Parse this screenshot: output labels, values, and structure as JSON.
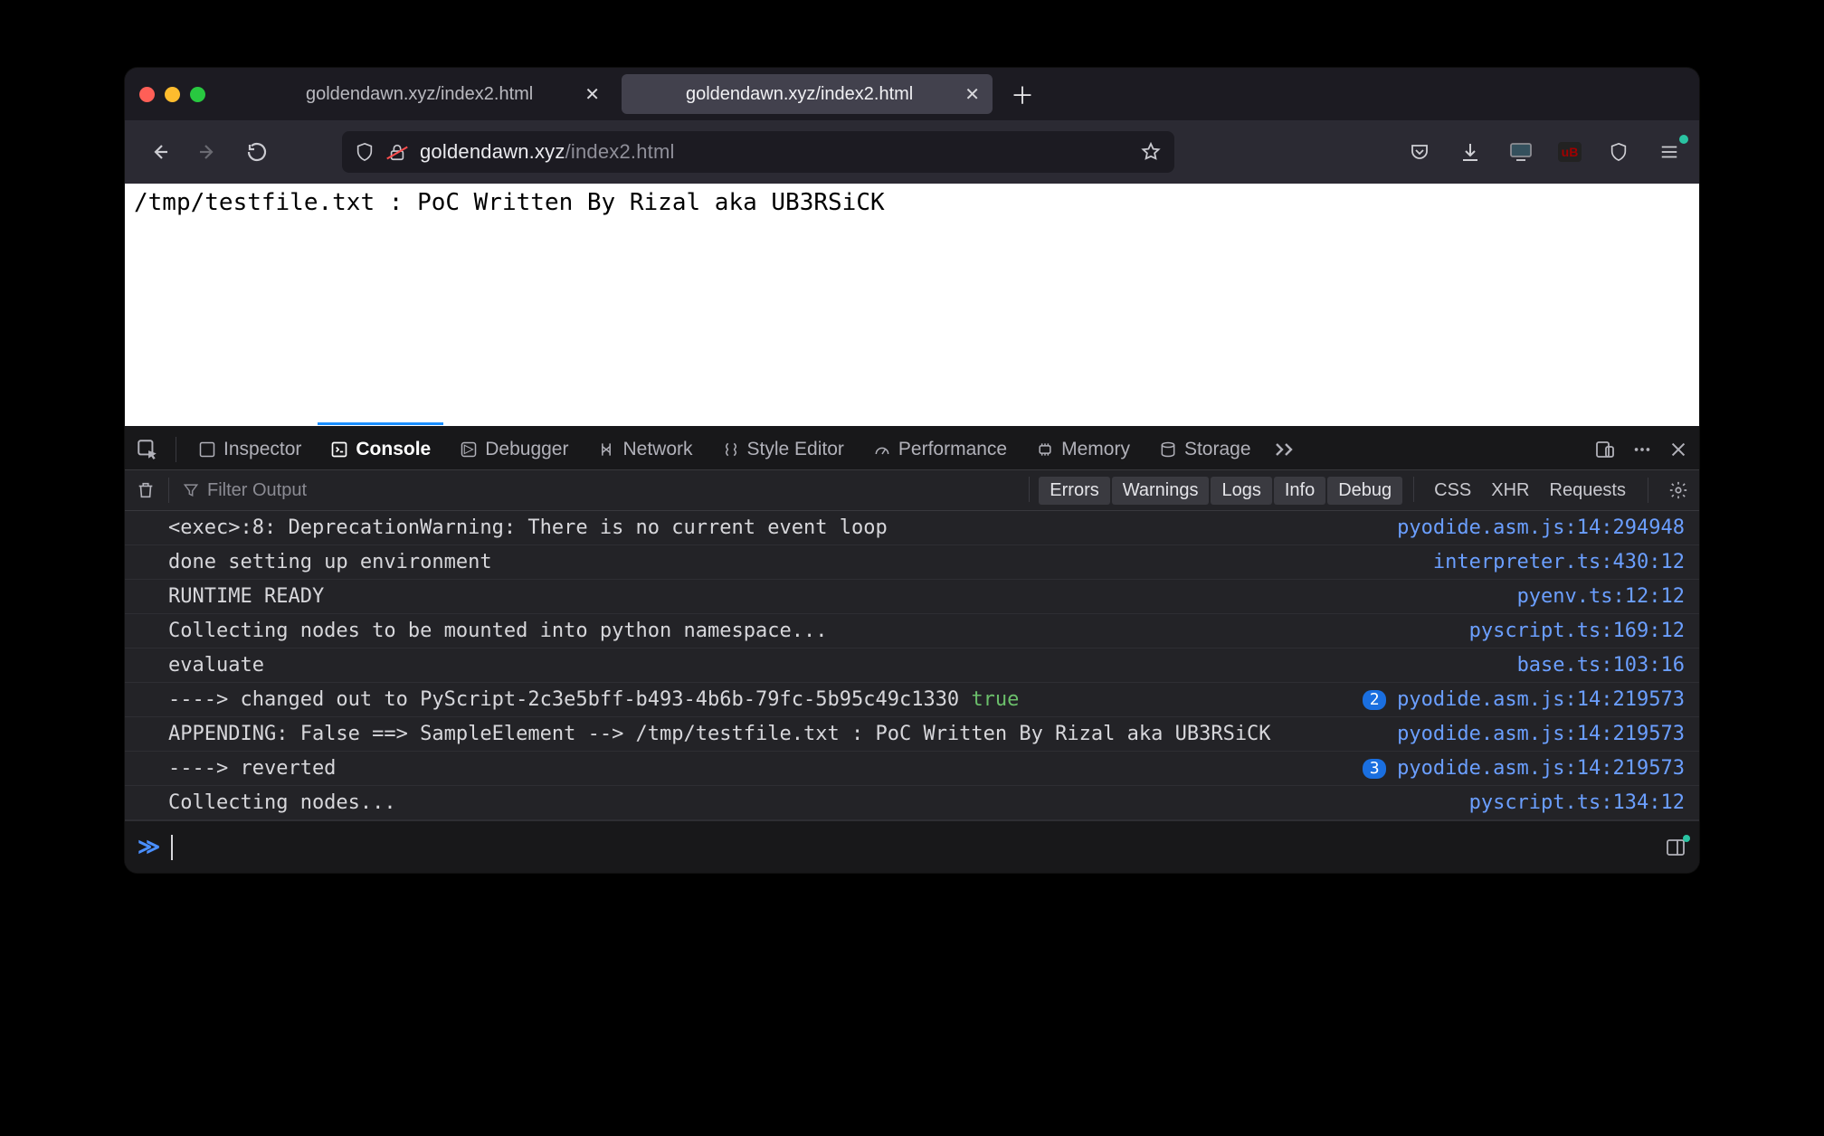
{
  "tabs": [
    {
      "title": "goldendawn.xyz/index2.html",
      "active": false
    },
    {
      "title": "goldendawn.xyz/index2.html",
      "active": true
    }
  ],
  "url": {
    "host": "goldendawn.xyz",
    "path": "/index2.html"
  },
  "page_text": "/tmp/testfile.txt : PoC Written By Rizal aka UB3RSiCK",
  "devtools": {
    "tabs": [
      "Inspector",
      "Console",
      "Debugger",
      "Network",
      "Style Editor",
      "Performance",
      "Memory",
      "Storage"
    ],
    "active_tab": "Console",
    "filter_placeholder": "Filter Output",
    "levels": [
      "Errors",
      "Warnings",
      "Logs",
      "Info",
      "Debug"
    ],
    "extra_filters": [
      "CSS",
      "XHR",
      "Requests"
    ],
    "logs": [
      {
        "msg": "<exec>:8: DeprecationWarning: There is no current event loop",
        "src": "pyodide.asm.js:14:294948"
      },
      {
        "msg": "done setting up environment",
        "src": "interpreter.ts:430:12"
      },
      {
        "msg": "RUNTIME READY",
        "src": "pyenv.ts:12:12"
      },
      {
        "msg": "Collecting nodes to be mounted into python namespace...",
        "src": "pyscript.ts:169:12"
      },
      {
        "msg": "evaluate",
        "src": "base.ts:103:16"
      },
      {
        "msg": "----> changed out to PyScript-2c3e5bff-b493-4b6b-79fc-5b95c49c1330 ",
        "trailing_true": "true",
        "badge": "2",
        "src": "pyodide.asm.js:14:219573"
      },
      {
        "msg": "APPENDING: False ==> SampleElement --> /tmp/testfile.txt : PoC Written By Rizal aka UB3RSiCK",
        "src": "pyodide.asm.js:14:219573"
      },
      {
        "msg": "----> reverted",
        "badge": "3",
        "src": "pyodide.asm.js:14:219573"
      },
      {
        "msg": "Collecting nodes...",
        "src": "pyscript.ts:134:12"
      }
    ]
  }
}
